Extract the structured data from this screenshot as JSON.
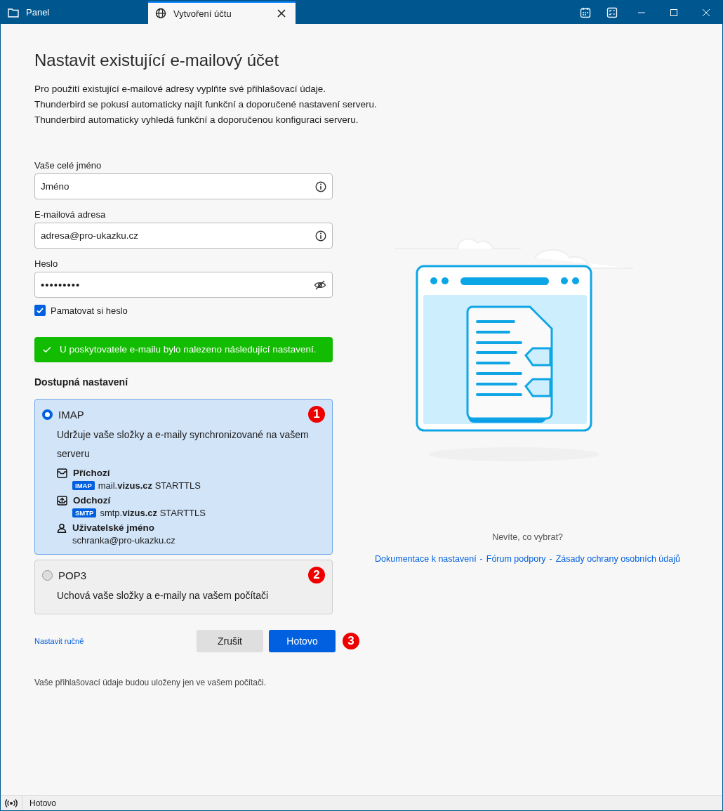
{
  "tabs": [
    {
      "label": "Panel",
      "selected": false,
      "closable": false
    },
    {
      "label": "Vytvoření účtu",
      "selected": true,
      "closable": true
    }
  ],
  "heading": "Nastavit existující e-mailový účet",
  "intro": [
    "Pro použití existující e-mailové adresy vyplňte své přihlašovací údaje.",
    "Thunderbird se pokusí automaticky najít funkční a doporučené nastavení serveru.",
    "Thunderbird automaticky vyhledá funkční a doporučenou konfiguraci serveru."
  ],
  "fields": [
    {
      "label": "Vaše celé jméno",
      "value": "Jméno",
      "kind": "info"
    },
    {
      "label": "E-mailová adresa",
      "value": "adresa@pro-ukazku.cz",
      "kind": "info"
    },
    {
      "label": "Heslo",
      "value": "•••••••••",
      "kind": "password"
    }
  ],
  "remember_password": {
    "label": "Pamatovat si heslo",
    "checked": true
  },
  "success_message": "U poskytovatele e-mailu bylo nalezeno následující nastavení.",
  "available_heading": "Dostupná nastavení",
  "options": [
    {
      "protocol": "IMAP",
      "description": "Udržuje vaše složky a e-maily synchronizované na vašem serveru",
      "selected": true,
      "marker": "1",
      "details": [
        {
          "kind": "incoming",
          "title": "Příchozí",
          "badge": "IMAP",
          "value": "mail.**vizus.cz** STARTTLS"
        },
        {
          "kind": "outgoing",
          "title": "Odchozí",
          "badge": "SMTP",
          "value": "smtp.**vizus.cz** STARTTLS"
        },
        {
          "kind": "user",
          "title": "Uživatelské jméno",
          "value": "schranka@pro-ukazku.cz"
        }
      ]
    },
    {
      "protocol": "POP3",
      "description": "Uchová vaše složky a e-maily na vašem počítači",
      "selected": false,
      "marker": "2"
    }
  ],
  "manual_link": "Nastavit ručně",
  "buttons": [
    {
      "label": "Zrušit",
      "kind": "secondary"
    },
    {
      "label": "Hotovo",
      "kind": "primary",
      "marker": "3"
    }
  ],
  "footnote": "Vaše přihlašovací údaje budou uloženy jen ve vašem počítači.",
  "help": {
    "question": "Nevíte, co vybrat?",
    "links": [
      "Dokumentace k nastavení",
      "Fórum podpory",
      "Zásady ochrany osobních údajů"
    ],
    "separator": "-"
  },
  "status_bar": {
    "text": "Hotovo"
  }
}
